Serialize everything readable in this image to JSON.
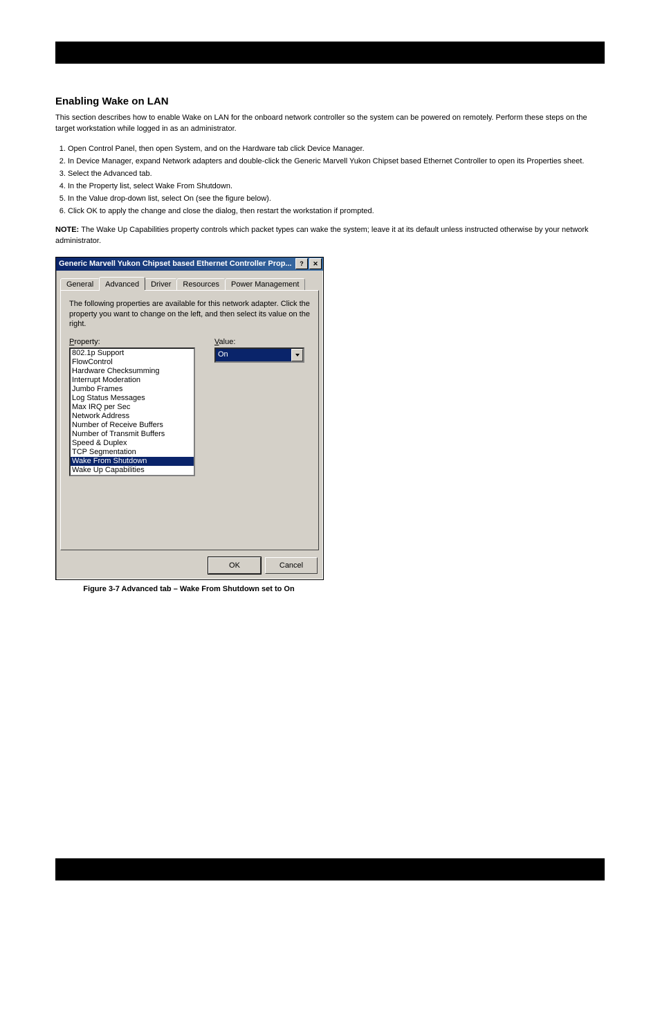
{
  "doc": {
    "section_title": "Enabling Wake on LAN",
    "intro": "This section describes how to enable Wake on LAN for the onboard network controller so the system can be powered on remotely. Perform these steps on the target workstation while logged in as an administrator.",
    "steps": [
      "Open Control Panel, then open System, and on the Hardware tab click Device Manager.",
      "In Device Manager, expand Network adapters and double-click the Generic Marvell Yukon Chipset based Ethernet Controller to open its Properties sheet.",
      "Select the Advanced tab.",
      "In the Property list, select Wake From Shutdown.",
      "In the Value drop-down list, select On (see the figure below).",
      "Click OK to apply the change and close the dialog, then restart the workstation if prompted."
    ],
    "note_label": "NOTE: ",
    "note_text": "The Wake Up Capabilities property controls which packet types can wake the system; leave it at its default unless instructed otherwise by your network administrator.",
    "figure_caption": "Figure 3-7  Advanced tab – Wake From Shutdown set to On"
  },
  "dialog": {
    "title": "Generic Marvell Yukon Chipset based Ethernet Controller Prop...",
    "tabs": [
      "General",
      "Advanced",
      "Driver",
      "Resources",
      "Power Management"
    ],
    "description": "The following properties are available for this network adapter. Click the property you want to change on the left, and then select its value on the right.",
    "property_label_rest": "roperty:",
    "value_label_rest": "alue:",
    "properties": [
      "802.1p Support",
      "FlowControl",
      "Hardware Checksumming",
      "Interrupt Moderation",
      "Jumbo Frames",
      "Log Status Messages",
      "Max IRQ per Sec",
      "Network Address",
      "Number of Receive Buffers",
      "Number of Transmit Buffers",
      "Speed & Duplex",
      "TCP Segmentation",
      "Wake From Shutdown",
      "Wake Up Capabilities"
    ],
    "value_selected": "On",
    "ok": "OK",
    "cancel": "Cancel"
  }
}
